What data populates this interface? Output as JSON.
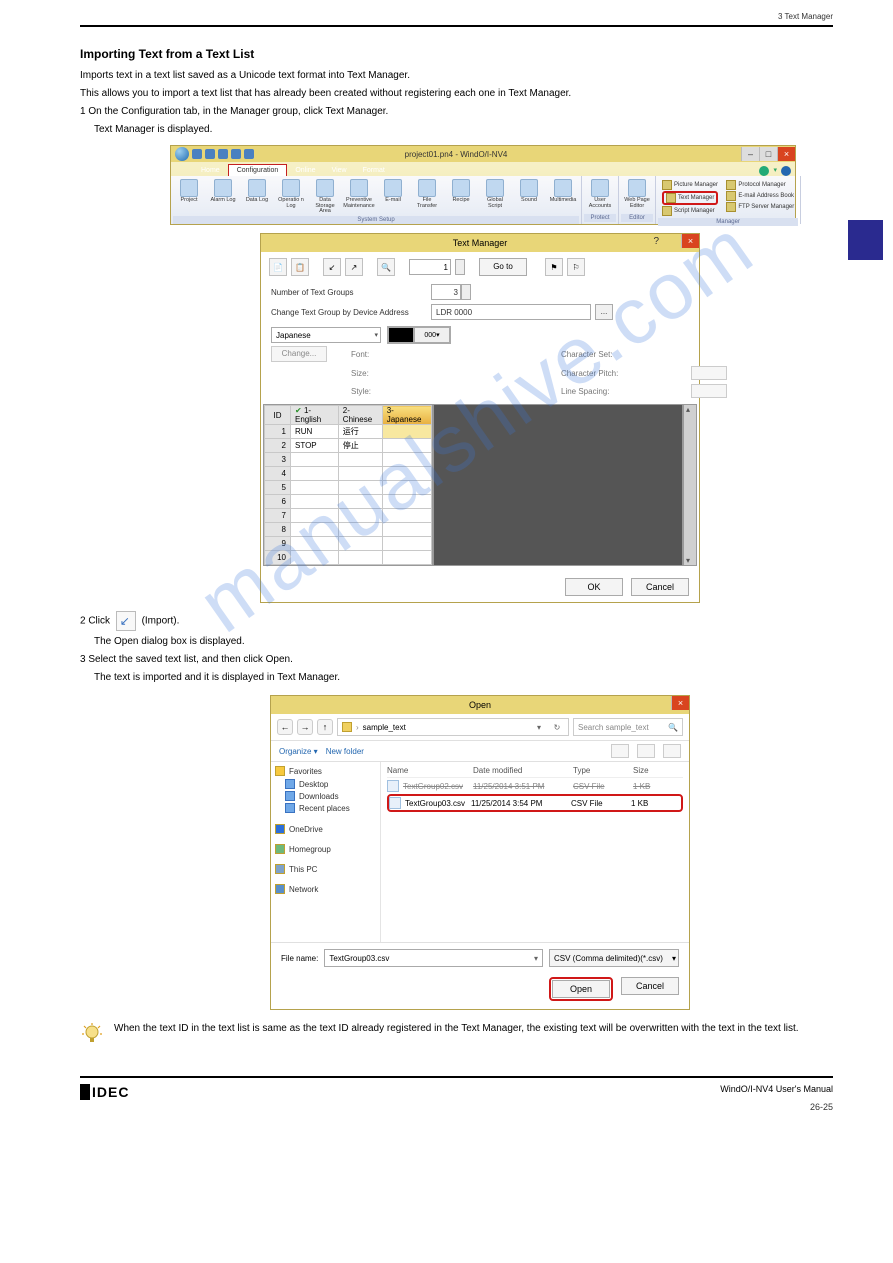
{
  "header": {
    "chapter_bar": "3 Text Manager",
    "page_ref_top": ""
  },
  "section": {
    "title": "Importing Text from a Text List",
    "intro": "Imports text in a text list saved as a Unicode text format into Text Manager.",
    "intro2": "This allows you to import a text list that has already been created without registering each one in Text Manager.",
    "step1": "1  On the Configuration tab, in the Manager group, click Text Manager.",
    "after1": "Text Manager is displayed.",
    "step2_a": "2  Click ",
    "step2_b": " (Import).",
    "after2": "The Open dialog box is displayed.",
    "step3": "3  Select the saved text list, and then click Open.",
    "after3": "The text is imported and it is displayed in Text Manager.",
    "tip": "When the text ID in the text list is same as the text ID already registered in the Text Manager, the existing text will be overwritten with the text in the text list."
  },
  "ribbon": {
    "window_title": "project01.pn4 - WindO/I-NV4",
    "tabs": [
      "Home",
      "Configuration",
      "Online",
      "View",
      "Format"
    ],
    "active_tab": "Configuration",
    "groups": {
      "system_setup": "System Setup",
      "protect": "Protect",
      "editor": "Editor",
      "manager": "Manager"
    },
    "buttons": {
      "project": "Project",
      "alarm_log": "Alarm Log",
      "data_log": "Data Log",
      "operation_log": "Operatio n Log",
      "data_storage": "Data Storage Area",
      "preventive": "Preventive Maintenance",
      "email": "E-mail",
      "file_transfer": "File Transfer",
      "recipe": "Recipe",
      "global_script": "Global Script",
      "sound": "Sound",
      "multimedia": "Multimedia",
      "user_accounts": "User Accounts",
      "web_page_editor": "Web Page Editor"
    },
    "managers": {
      "picture": "Picture Manager",
      "text": "Text Manager",
      "script": "Script Manager",
      "protocol": "Protocol Manager",
      "email_book": "E-mail Address Book",
      "ftp": "FTP Server Manager"
    },
    "minimize": "–",
    "maximize": "□",
    "close": "×"
  },
  "tm": {
    "title": "Text Manager",
    "goto": "Go to",
    "goto_value": "1",
    "num_groups_label": "Number of Text Groups",
    "num_groups_value": "3",
    "change_by_label": "Change Text Group by Device Address",
    "device_value": "LDR 0000",
    "lang_combo": "Japanese",
    "color_code": "000",
    "change_btn": "Change...",
    "font_label": "Font:",
    "size_label": "Size:",
    "style_label": "Style:",
    "charset_label": "Character Set:",
    "charpitch_label": "Character Pitch:",
    "linespacing_label": "Line Spacing:",
    "cols": {
      "id": "ID",
      "c1": "1-English",
      "c2": "2-Chinese",
      "c3": "3-Japanese"
    },
    "rows": [
      {
        "id": "1",
        "en": "RUN",
        "cn": "运行",
        "jp": ""
      },
      {
        "id": "2",
        "en": "STOP",
        "cn": "停止",
        "jp": ""
      },
      {
        "id": "3",
        "en": "",
        "cn": "",
        "jp": ""
      },
      {
        "id": "4",
        "en": "",
        "cn": "",
        "jp": ""
      },
      {
        "id": "5",
        "en": "",
        "cn": "",
        "jp": ""
      },
      {
        "id": "6",
        "en": "",
        "cn": "",
        "jp": ""
      },
      {
        "id": "7",
        "en": "",
        "cn": "",
        "jp": ""
      },
      {
        "id": "8",
        "en": "",
        "cn": "",
        "jp": ""
      },
      {
        "id": "9",
        "en": "",
        "cn": "",
        "jp": ""
      },
      {
        "id": "10",
        "en": "",
        "cn": "",
        "jp": ""
      }
    ],
    "ok": "OK",
    "cancel": "Cancel"
  },
  "import_icon_label": "(Import)",
  "open": {
    "title": "Open",
    "back": "←",
    "fwd": "→",
    "up": "↑",
    "breadcrumb_root": "",
    "breadcrumb_item": "sample_text",
    "refresh": "↻",
    "search_placeholder": "Search sample_text",
    "organize": "Organize ▾",
    "newfolder": "New folder",
    "cols": {
      "name": "Name",
      "date": "Date modified",
      "type": "Type",
      "size": "Size"
    },
    "sidebar": {
      "favorites": "Favorites",
      "desktop": "Desktop",
      "downloads": "Downloads",
      "recent": "Recent places",
      "onedrive": "OneDrive",
      "homegroup": "Homegroup",
      "thispc": "This PC",
      "network": "Network"
    },
    "files": [
      {
        "name": "TextGroup02.csv",
        "date": "11/25/2014 3:51 PM",
        "type": "CSV File",
        "size": "1 KB"
      },
      {
        "name": "TextGroup03.csv",
        "date": "11/25/2014 3:54 PM",
        "type": "CSV File",
        "size": "1 KB"
      }
    ],
    "filename_label": "File name:",
    "filename_value": "TextGroup03.csv",
    "filetype": "CSV (Comma delimited)(*.csv)",
    "open_btn": "Open",
    "cancel_btn": "Cancel"
  },
  "footer": {
    "manual": "WindO/I-NV4 User's Manual",
    "page": "26-25",
    "logo": "IDEC"
  }
}
